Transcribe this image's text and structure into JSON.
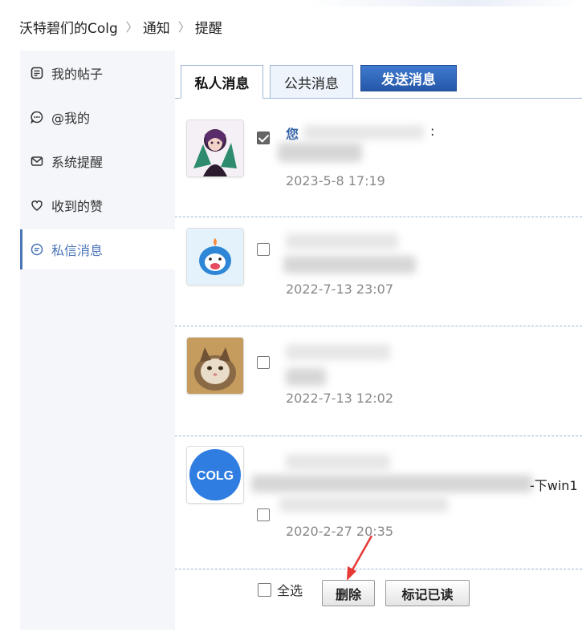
{
  "breadcrumb": {
    "home": "沃特碧们的Colg",
    "sep1": "〉",
    "notice": "通知",
    "sep2": "〉",
    "current": "提醒"
  },
  "sidebar": {
    "items": [
      {
        "label": "我的帖子",
        "icon": "post-icon"
      },
      {
        "label": "@我的",
        "icon": "at-icon"
      },
      {
        "label": "系统提醒",
        "icon": "mail-icon"
      },
      {
        "label": "收到的赞",
        "icon": "heart-icon"
      },
      {
        "label": "私信消息",
        "icon": "message-icon",
        "active": true
      }
    ],
    "active_color": "#4a74b8"
  },
  "tabs": {
    "private": "私人消息",
    "public": "公共消息",
    "send": "发送消息"
  },
  "messages": [
    {
      "sender": "您",
      "preview": "",
      "date": "2023-5-8 17:19",
      "checked": true
    },
    {
      "sender": "",
      "preview": "",
      "date": "2022-7-13 23:07",
      "checked": false
    },
    {
      "sender": "",
      "preview": "",
      "date": "2022-7-13 12:02",
      "checked": false
    },
    {
      "sender": "",
      "preview": "-下win1",
      "date": "2020-2-27 20:35",
      "checked": false
    }
  ],
  "colg_logo_text": "COLG",
  "footer": {
    "select_all": "全选",
    "delete": "删除",
    "mark_read": "标记已读"
  },
  "colors": {
    "link_blue": "#2f5fa5",
    "send_button": "#2557a8",
    "arrow": "#e53935"
  }
}
